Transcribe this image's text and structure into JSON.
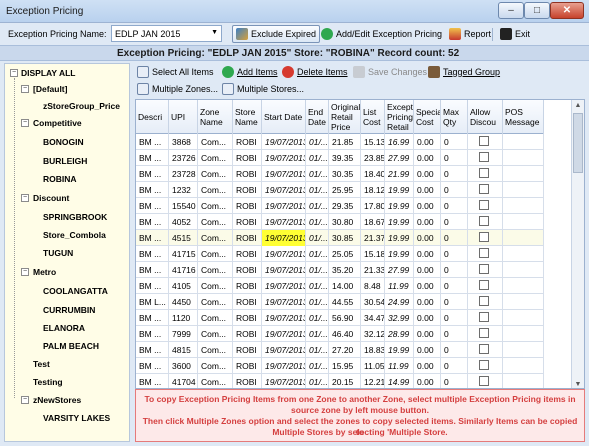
{
  "window": {
    "title": "Exception Pricing",
    "min": "–",
    "max": "□",
    "close": "✕"
  },
  "toolbar": {
    "name_label": "Exception Pricing Name:",
    "name_value": "EDLP JAN 2015",
    "exclude_expired": "Exclude Expired",
    "add_edit": "Add/Edit Exception Pricing",
    "report": "Report",
    "exit": "Exit"
  },
  "header": {
    "text": "Exception Pricing: \"EDLP JAN 2015\"   Store: \"ROBINA\"   Record count: 52"
  },
  "tree": {
    "root": "DISPLAY ALL",
    "default": "[Default]",
    "default_child": "zStoreGroup_Price",
    "competitive": "Competitive",
    "competitive_children": [
      "BONOGIN",
      "BURLEIGH",
      "ROBINA"
    ],
    "discount": "Discount",
    "discount_children": [
      "SPRINGBROOK",
      "Store_Combola",
      "TUGUN"
    ],
    "metro": "Metro",
    "metro_children": [
      "COOLANGATTA",
      "CURRUMBIN",
      "ELANORA",
      "PALM BEACH"
    ],
    "test": "Test",
    "testing": "Testing",
    "znew": "zNewStores",
    "znew_children": [
      "VARSITY LAKES"
    ]
  },
  "actions": {
    "select_all": "Select All Items",
    "add_items": "Add Items",
    "delete_items": "Delete Items",
    "save_changes": "Save Changes",
    "tagged_group": "Tagged Group",
    "multiple_zones": "Multiple Zones...",
    "multiple_stores": "Multiple Stores..."
  },
  "grid": {
    "columns": [
      "Descri",
      "UPI",
      "Zone Name",
      "Store Name",
      "Start Date",
      "End Date",
      "Original Retail Price",
      "List Cost",
      "Exception Pricing Retail",
      "Special Cost",
      "Max Qty",
      "Allow Discou",
      "POS Message"
    ],
    "rows": [
      [
        "BM ...",
        "3868",
        "Com...",
        "ROBI",
        "19/07/2013",
        "01/...",
        "21.85",
        "15.13",
        "16.99",
        "0.00",
        "0"
      ],
      [
        "BM ...",
        "23726",
        "Com...",
        "ROBI",
        "19/07/2013",
        "01/...",
        "39.35",
        "23.85",
        "27.99",
        "0.00",
        "0"
      ],
      [
        "BM ...",
        "23728",
        "Com...",
        "ROBI",
        "19/07/2013",
        "01/...",
        "30.35",
        "18.40",
        "21.99",
        "0.00",
        "0"
      ],
      [
        "BM ...",
        "1232",
        "Com...",
        "ROBI",
        "19/07/2013",
        "01/...",
        "25.95",
        "18.12",
        "19.99",
        "0.00",
        "0"
      ],
      [
        "BM ...",
        "15540",
        "Com...",
        "ROBI",
        "19/07/2013",
        "01/...",
        "29.35",
        "17.80",
        "19.99",
        "0.00",
        "0"
      ],
      [
        "BM ...",
        "4052",
        "Com...",
        "ROBI",
        "19/07/2013",
        "01/...",
        "30.80",
        "18.67",
        "19.99",
        "0.00",
        "0"
      ],
      [
        "BM ...",
        "4515",
        "Com...",
        "ROBI",
        "19/07/2013",
        "01/...",
        "30.85",
        "21.37",
        "19.99",
        "0.00",
        "0"
      ],
      [
        "BM ...",
        "41715",
        "Com...",
        "ROBI",
        "19/07/2013",
        "01/...",
        "25.05",
        "15.18",
        "19.99",
        "0.00",
        "0"
      ],
      [
        "BM ...",
        "41716",
        "Com...",
        "ROBI",
        "19/07/2013",
        "01/...",
        "35.20",
        "21.33",
        "27.99",
        "0.00",
        "0"
      ],
      [
        "BM ...",
        "4105",
        "Com...",
        "ROBI",
        "19/07/2013",
        "01/...",
        "14.00",
        "8.48",
        "11.99",
        "0.00",
        "0"
      ],
      [
        "BM L...",
        "4450",
        "Com...",
        "ROBI",
        "19/07/2013",
        "01/...",
        "44.55",
        "30.54",
        "24.99",
        "0.00",
        "0"
      ],
      [
        "BM ...",
        "1120",
        "Com...",
        "ROBI",
        "19/07/2013",
        "01/...",
        "56.90",
        "34.47",
        "32.99",
        "0.00",
        "0"
      ],
      [
        "BM ...",
        "7999",
        "Com...",
        "ROBI",
        "19/07/2013",
        "01/...",
        "46.40",
        "32.12",
        "28.99",
        "0.00",
        "0"
      ],
      [
        "BM ...",
        "4815",
        "Com...",
        "ROBI",
        "19/07/2013",
        "01/...",
        "27.20",
        "18.83",
        "19.99",
        "0.00",
        "0"
      ],
      [
        "BM ...",
        "3600",
        "Com...",
        "ROBI",
        "19/07/2013",
        "01/...",
        "15.95",
        "11.05",
        "11.99",
        "0.00",
        "0"
      ],
      [
        "BM ...",
        "41704",
        "Com...",
        "ROBI",
        "19/07/2013",
        "01/...",
        "20.15",
        "12.21",
        "14.99",
        "0.00",
        "0"
      ]
    ],
    "highlight_row": 6,
    "highlight_color": "#ffff33"
  },
  "info": {
    "line1": "To copy Exception Pricing Items from one Zone to another Zone, select multiple Exception Pricing items in",
    "line2": "source zone by left mouse button.",
    "line3": "Then click Multiple Zones option and select the zones to copy selected items. Similarly Items can be copied to",
    "line4": "Multiple Stores by selecting 'Multiple Store."
  },
  "colors": {
    "accent": "#d43f3f",
    "tree_bg": "#fffde7",
    "band": "#c9d8ec"
  }
}
